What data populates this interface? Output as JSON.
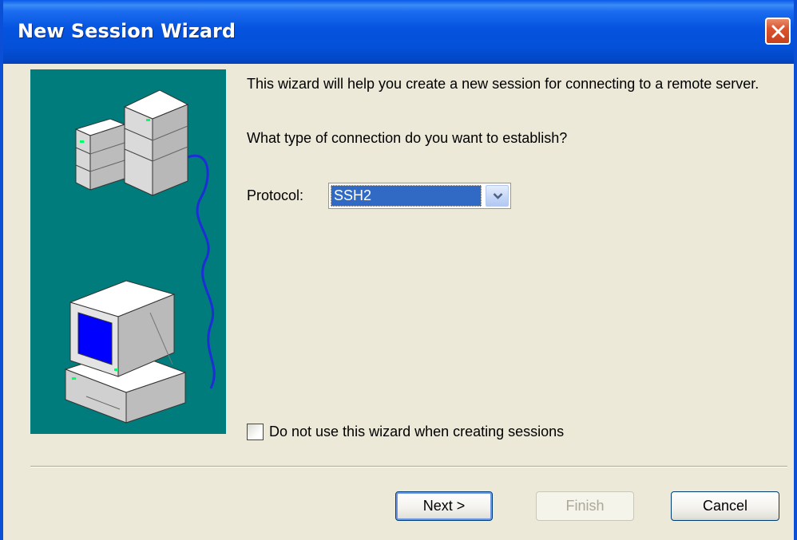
{
  "window": {
    "title": "New Session Wizard"
  },
  "content": {
    "intro": "This wizard will help you create a new session for connecting to a remote server.",
    "question": "What type of connection do you want to establish?",
    "protocol_label": "Protocol:",
    "protocol_value": "SSH2",
    "checkbox_label": "Do not use this wizard when creating sessions",
    "checkbox_checked": false
  },
  "buttons": {
    "next": "Next >",
    "finish": "Finish",
    "cancel": "Cancel"
  },
  "icons": {
    "close": "close-icon",
    "dropdown": "chevron-down-icon",
    "illustration": "servers-and-computer-illustration"
  },
  "colors": {
    "titlebar": "#0553df",
    "illustration_bg": "#007c7c",
    "selection": "#316ac5",
    "window_bg": "#ece9d8"
  }
}
